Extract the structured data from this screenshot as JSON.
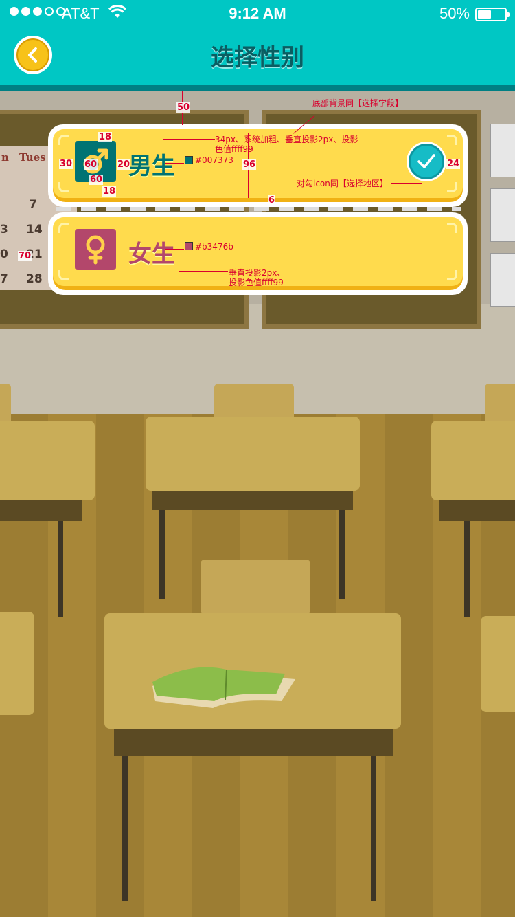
{
  "status_bar": {
    "carrier": "AT&T",
    "time": "9:12 AM",
    "battery": "50%",
    "battery_level": 0.5,
    "signal_bars_filled": 3,
    "signal_bars_total": 5
  },
  "header": {
    "title": "选择性别",
    "back_icon": "chevron-left-icon"
  },
  "options": [
    {
      "label": "男生",
      "icon": "male-symbol-icon",
      "color": "#007373",
      "selected": true
    },
    {
      "label": "女生",
      "icon": "female-symbol-icon",
      "color": "#b3476b",
      "selected": false
    }
  ],
  "background": {
    "calendar_header": [
      "n",
      "Tues"
    ],
    "calendar_numbers": [
      "7",
      "14",
      "21",
      "28",
      "3",
      "0",
      "7"
    ]
  },
  "annotations": {
    "bg_note": "底部背景同【选择学段】",
    "font_note_1": "34px、系统加粗、垂直投影2px、投影",
    "font_note_2": "色值ffff99",
    "male_color": "#007373",
    "female_color": "#b3476b",
    "check_note": "对勾icon同【选择地区】",
    "shadow_note_1": "垂直投影2px、",
    "shadow_note_2": "投影色值ffff99",
    "dim_50": "50",
    "dim_18_top": "18",
    "dim_18_bottom": "18",
    "dim_30": "30",
    "dim_60_w": "60",
    "dim_60_h": "60",
    "dim_20": "20",
    "dim_96": "96",
    "dim_24": "24",
    "dim_6": "6",
    "dim_70": "70"
  },
  "colors": {
    "header_bg": "#00c7c4",
    "title": "#0a5e62",
    "card_face": "#ffdb4d",
    "check": "#16bcc6",
    "annotation": "#d9002e"
  }
}
